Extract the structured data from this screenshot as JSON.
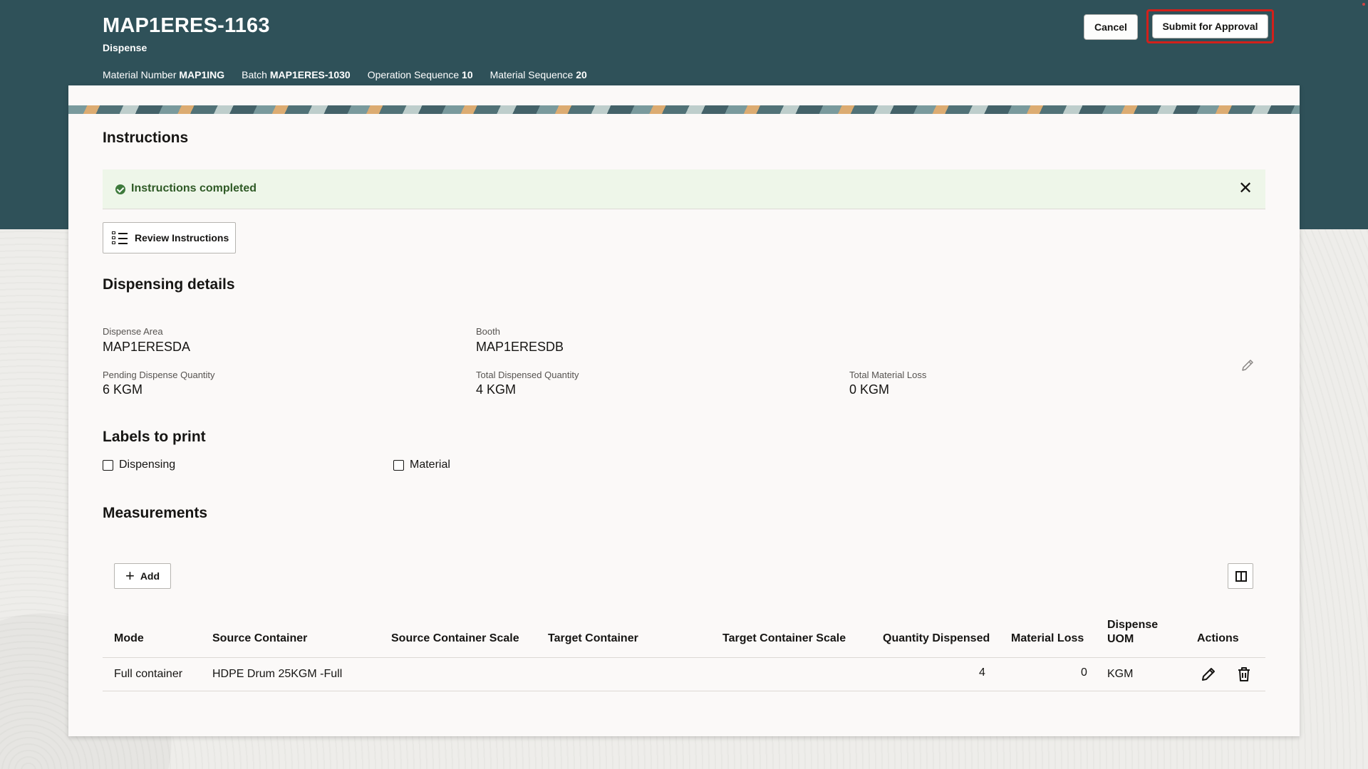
{
  "header": {
    "title": "MAP1ERES-1163",
    "subtitle": "Dispense",
    "meta": [
      {
        "label": "Material Number",
        "value": "MAP1ING"
      },
      {
        "label": "Batch",
        "value": "MAP1ERES-1030"
      },
      {
        "label": "Operation Sequence",
        "value": "10"
      },
      {
        "label": "Material Sequence",
        "value": "20"
      }
    ],
    "cancel_label": "Cancel",
    "submit_label": "Submit for Approval"
  },
  "instructions": {
    "title": "Instructions",
    "alert_text": "Instructions completed",
    "review_label": "Review Instructions"
  },
  "dispensing": {
    "title": "Dispensing details",
    "fields": [
      {
        "label": "Dispense Area",
        "value": "MAP1ERESDA"
      },
      {
        "label": "Booth",
        "value": "MAP1ERESDB"
      },
      {
        "label": "Pending Dispense Quantity",
        "value": "6 KGM"
      },
      {
        "label": "Total Dispensed Quantity",
        "value": "4 KGM"
      },
      {
        "label": "Total Material Loss",
        "value": "0 KGM"
      }
    ]
  },
  "labels": {
    "title": "Labels to print",
    "options": [
      {
        "label": "Dispensing",
        "checked": false
      },
      {
        "label": "Material",
        "checked": false
      }
    ]
  },
  "measurements": {
    "title": "Measurements",
    "add_label": "Add",
    "columns": [
      "Mode",
      "Source Container",
      "Source Container Scale",
      "Target Container",
      "Target Container Scale",
      "Quantity Dispensed",
      "Material Loss",
      "Dispense UOM",
      "Actions"
    ],
    "rows": [
      {
        "mode": "Full container",
        "source_container": "HDPE Drum 25KGM -Full",
        "source_container_scale": "",
        "target_container": "",
        "target_container_scale": "",
        "quantity_dispensed": "4",
        "material_loss": "0",
        "uom": "KGM"
      }
    ]
  },
  "colors": {
    "header_bg": "#2f5159",
    "alert_bg": "#eef6e9",
    "highlight": "#d3201b"
  }
}
